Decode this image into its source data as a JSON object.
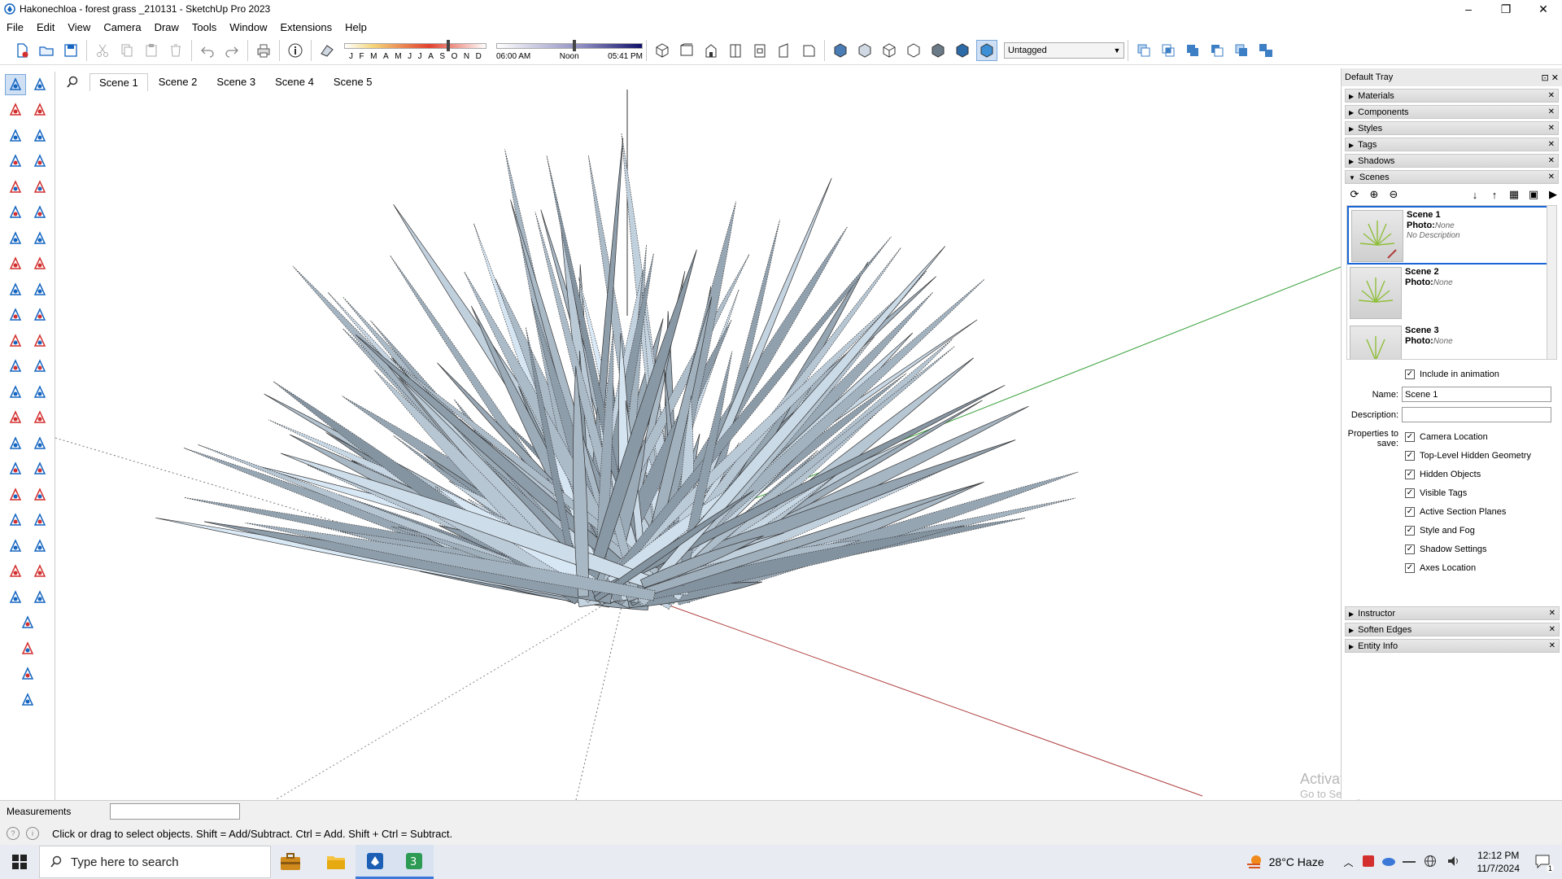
{
  "window": {
    "title": "Hakonechloa - forest grass _210131 - SketchUp Pro 2023"
  },
  "menu": [
    "File",
    "Edit",
    "View",
    "Camera",
    "Draw",
    "Tools",
    "Window",
    "Extensions",
    "Help"
  ],
  "toolbar": {
    "months": [
      "J",
      "F",
      "M",
      "A",
      "M",
      "J",
      "J",
      "A",
      "S",
      "O",
      "N",
      "D"
    ],
    "time_start": "06:00 AM",
    "time_mid": "Noon",
    "time_end": "05:41 PM",
    "tag_selected": "Untagged"
  },
  "scene_tabs": [
    "Scene 1",
    "Scene 2",
    "Scene 3",
    "Scene 4",
    "Scene 5"
  ],
  "tray": {
    "title": "Default Tray",
    "panels_top": [
      "Materials",
      "Components",
      "Styles",
      "Tags",
      "Shadows"
    ],
    "scenes_panel": "Scenes",
    "scenes": [
      {
        "name": "Scene 1",
        "photo_label": "Photo:",
        "photo": "None",
        "description": "No Description"
      },
      {
        "name": "Scene 2",
        "photo_label": "Photo:",
        "photo": "None"
      },
      {
        "name": "Scene 3",
        "photo_label": "Photo:",
        "photo": "None"
      }
    ],
    "include_animation": "Include in animation",
    "name_label": "Name:",
    "name_value": "Scene 1",
    "description_label": "Description:",
    "description_value": "",
    "properties_label": "Properties to save:",
    "properties": [
      "Camera Location",
      "Top-Level Hidden Geometry",
      "Hidden Objects",
      "Visible Tags",
      "Active Section Planes",
      "Style and Fog",
      "Shadow Settings",
      "Axes Location"
    ],
    "panels_bottom": [
      "Instructor",
      "Soften Edges",
      "Entity Info"
    ]
  },
  "measurements": {
    "label": "Measurements",
    "value": ""
  },
  "status": {
    "text": "Click or drag to select objects. Shift = Add/Subtract. Ctrl = Add. Shift + Ctrl = Subtract."
  },
  "watermark": {
    "line1": "Activate Windows",
    "line2": "Go to Settings to activate Windows."
  },
  "taskbar": {
    "search_placeholder": "Type here to search",
    "weather": "28°C  Haze",
    "time": "12:12 PM",
    "date": "11/7/2024",
    "notification_count": "1"
  },
  "colors": {
    "accent": "#1a66d6",
    "axis_red": "#b04040",
    "axis_green": "#3aa13a",
    "grass": "#a9b6c0"
  }
}
